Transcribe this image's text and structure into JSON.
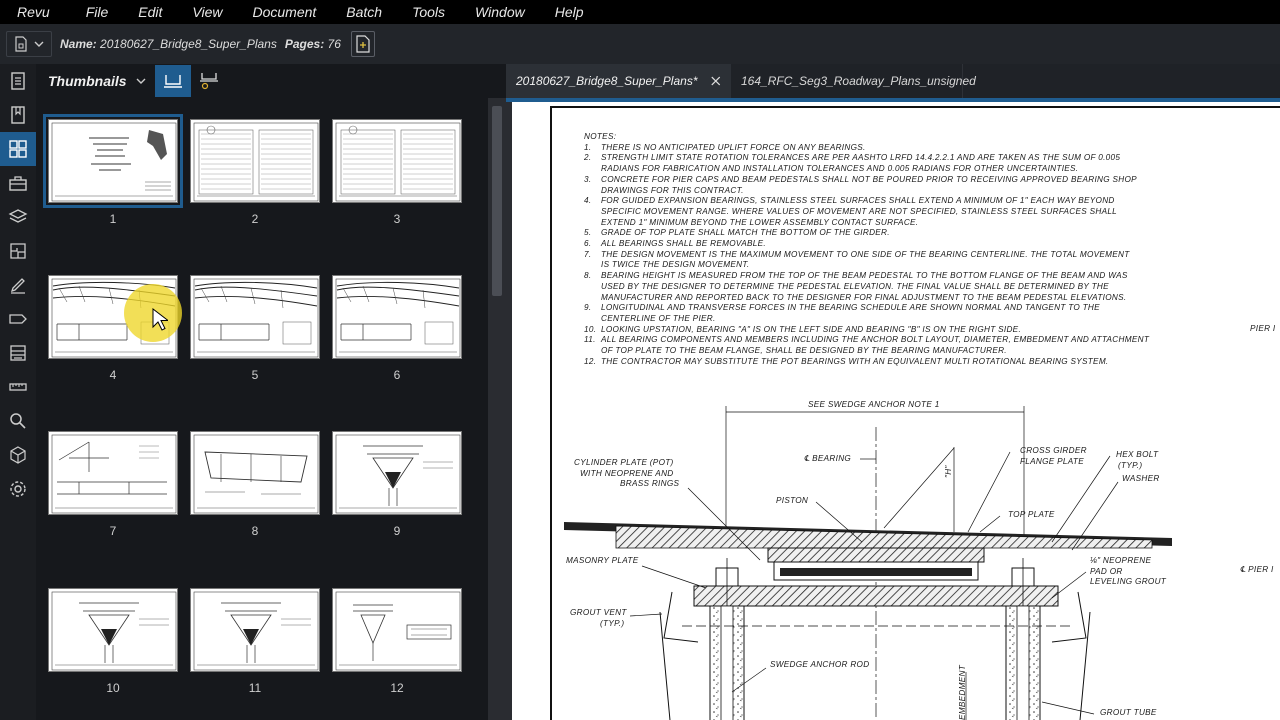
{
  "menubar": {
    "items": [
      "Revu",
      "File",
      "Edit",
      "View",
      "Document",
      "Batch",
      "Tools",
      "Window",
      "Help"
    ]
  },
  "docbar": {
    "name_label": "Name:",
    "name_value": "20180627_Bridge8_Super_Plans",
    "pages_label": "Pages:",
    "pages_value": "76"
  },
  "panel": {
    "title": "Thumbnails",
    "thumbnails": [
      {
        "page": "1",
        "selected": true
      },
      {
        "page": "2"
      },
      {
        "page": "3"
      },
      {
        "page": "4"
      },
      {
        "page": "5"
      },
      {
        "page": "6"
      },
      {
        "page": "7"
      },
      {
        "page": "8"
      },
      {
        "page": "9"
      },
      {
        "page": "10"
      },
      {
        "page": "11"
      },
      {
        "page": "12"
      }
    ]
  },
  "tabs": [
    {
      "label": "20180627_Bridge8_Super_Plans*",
      "active": true
    },
    {
      "label": "164_RFC_Seg3_Roadway_Plans_unsigned",
      "active": false
    }
  ],
  "document": {
    "notes_heading": "NOTES:",
    "notes": [
      {
        "n": "1.",
        "lines": [
          "THERE IS NO ANTICIPATED UPLIFT FORCE ON ANY BEARINGS."
        ]
      },
      {
        "n": "2.",
        "lines": [
          "STRENGTH LIMIT STATE ROTATION TOLERANCES ARE PER AASHTO LRFD 14.4.2.2.1 AND ARE TAKEN AS THE SUM OF 0.005",
          "RADIANS FOR FABRICATION AND INSTALLATION TOLERANCES AND 0.005 RADIANS FOR OTHER UNCERTAINTIES."
        ]
      },
      {
        "n": "3.",
        "lines": [
          "CONCRETE FOR PIER CAPS AND BEAM PEDESTALS SHALL NOT BE POURED PRIOR TO RECEIVING APPROVED BEARING SHOP",
          "DRAWINGS FOR THIS CONTRACT."
        ]
      },
      {
        "n": "4.",
        "lines": [
          "FOR GUIDED EXPANSION BEARINGS, STAINLESS STEEL SURFACES SHALL EXTEND A MINIMUM OF 1\" EACH WAY BEYOND",
          "SPECIFIC MOVEMENT RANGE.  WHERE VALUES OF MOVEMENT ARE NOT SPECIFIED, STAINLESS STEEL SURFACES SHALL",
          "EXTEND 1\" MINIMUM BEYOND THE LOWER ASSEMBLY CONTACT SURFACE."
        ]
      },
      {
        "n": "5.",
        "lines": [
          "GRADE OF TOP PLATE SHALL MATCH THE BOTTOM OF THE GIRDER."
        ]
      },
      {
        "n": "6.",
        "lines": [
          "ALL BEARINGS SHALL BE REMOVABLE."
        ]
      },
      {
        "n": "7.",
        "lines": [
          "THE DESIGN MOVEMENT IS THE MAXIMUM MOVEMENT TO ONE SIDE OF THE BEARING CENTERLINE.  THE TOTAL MOVEMENT",
          "IS TWICE THE DESIGN MOVEMENT."
        ]
      },
      {
        "n": "8.",
        "lines": [
          "BEARING HEIGHT IS MEASURED FROM THE TOP OF THE BEAM PEDESTAL TO THE BOTTOM FLANGE OF THE BEAM AND WAS",
          "USED BY THE DESIGNER TO DETERMINE THE PEDESTAL ELEVATION.  THE FINAL VALUE SHALL BE DETERMINED BY THE",
          "MANUFACTURER AND REPORTED BACK TO THE DESIGNER FOR FINAL ADJUSTMENT TO THE BEAM PEDESTAL ELEVATIONS."
        ]
      },
      {
        "n": "9.",
        "lines": [
          "LONGITUDINAL AND TRANSVERSE FORCES IN THE BEARING SCHEDULE ARE SHOWN NORMAL AND TANGENT TO THE",
          "CENTERLINE OF THE PIER."
        ]
      },
      {
        "n": "10.",
        "lines": [
          "LOOKING UPSTATION, BEARING \"A\" IS ON THE LEFT SIDE AND BEARING \"B\" IS ON THE RIGHT SIDE."
        ]
      },
      {
        "n": "11.",
        "lines": [
          "ALL BEARING COMPONENTS AND MEMBERS INCLUDING THE ANCHOR BOLT LAYOUT, DIAMETER, EMBEDMENT AND ATTACHMENT",
          "OF TOP PLATE TO THE BEAM FLANGE, SHALL BE DESIGNED BY THE BEARING MANUFACTURER."
        ]
      },
      {
        "n": "12.",
        "lines": [
          "THE CONTRACTOR MAY SUBSTITUTE THE POT BEARINGS WITH AN EQUIVALENT MULTI ROTATIONAL BEARING SYSTEM."
        ]
      }
    ],
    "pier_label_1": "PIER I",
    "pier_label_2": "℄ PIER I",
    "labels": {
      "see_swedge": "SEE SWEDGE ANCHOR NOTE 1",
      "bearing_cl": "℄ BEARING",
      "cylinder_1": "CYLINDER PLATE (POT)",
      "cylinder_2": "WITH NEOPRENE AND",
      "cylinder_3": "BRASS RINGS",
      "piston": "PISTON",
      "h_dim": "\"H\"",
      "cross_girder_1": "CROSS GIRDER",
      "cross_girder_2": "FLANGE PLATE",
      "hex_bolt_1": "HEX BOLT",
      "hex_bolt_2": "(TYP.)",
      "washer": "WASHER",
      "top_plate": "TOP PLATE",
      "masonry_plate": "MASONRY PLATE",
      "neoprene_1": "⅛\" NEOPRENE",
      "neoprene_2": "PAD OR",
      "neoprene_3": "LEVELING GROUT",
      "grout_vent_1": "GROUT VENT",
      "grout_vent_2": "(TYP.)",
      "swedge_rod": "SWEDGE ANCHOR ROD",
      "embedment": "EMBEDMENT",
      "grout_tube": "GROUT TUBE"
    }
  }
}
